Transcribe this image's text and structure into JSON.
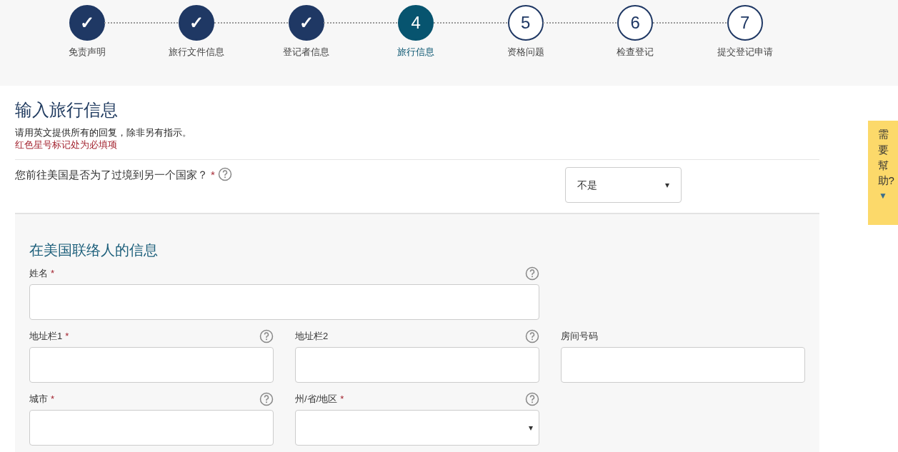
{
  "steps": [
    {
      "marker": "✓",
      "label": "免责声明",
      "completed": true,
      "selected": false
    },
    {
      "marker": "✓",
      "label": "旅行文件信息",
      "completed": true,
      "selected": false
    },
    {
      "marker": "✓",
      "label": "登记者信息",
      "completed": true,
      "selected": false
    },
    {
      "marker": "4",
      "label": "旅行信息",
      "completed": false,
      "selected": true
    },
    {
      "marker": "5",
      "label": "资格问题",
      "completed": false,
      "selected": false
    },
    {
      "marker": "6",
      "label": "检查登记",
      "completed": false,
      "selected": false
    },
    {
      "marker": "7",
      "label": "提交登记申请",
      "completed": false,
      "selected": false
    }
  ],
  "page": {
    "title": "输入旅行信息",
    "instructions": "请用英文提供所有的回复，除非另有指示。",
    "required_note": "红色星号标记处为必填项"
  },
  "question": {
    "label": "您前往美国是否为了过境到另一个国家？",
    "required": "*",
    "help": true,
    "value": "不是",
    "caret": "▾"
  },
  "section": {
    "title": "在美国联络人的信息",
    "rows": [
      [
        {
          "label": "姓名",
          "required": "*",
          "help": true,
          "kind": "input"
        }
      ],
      [
        {
          "label": "地址栏1",
          "required": "*",
          "help": true,
          "kind": "input"
        },
        {
          "label": "地址栏2",
          "help": true,
          "kind": "input"
        },
        {
          "label": "房间号码",
          "help": false,
          "kind": "input"
        }
      ],
      [
        {
          "label": "城市",
          "required": "*",
          "help": true,
          "kind": "input"
        },
        {
          "label": "州/省/地区",
          "required": "*",
          "help": true,
          "kind": "select",
          "caret": "▾"
        }
      ]
    ]
  },
  "help_tab": {
    "label": "需要幫助?",
    "arrow": "▼"
  }
}
